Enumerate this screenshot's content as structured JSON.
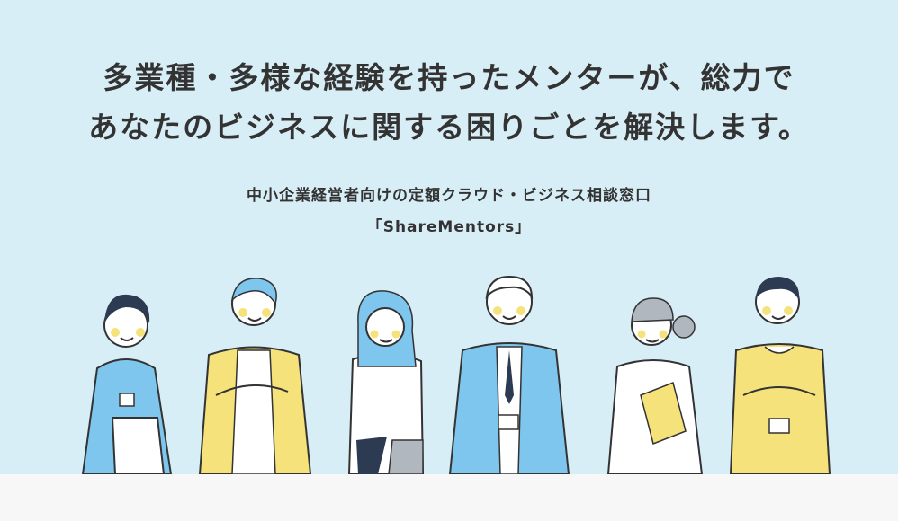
{
  "hero": {
    "headline_line1": "多業種・多様な経験を持ったメンターが、総力で",
    "headline_line2": "あなたのビジネスに関する困りごとを解決します。",
    "subtitle_line1": "中小企業経営者向けの定額クラウド・ビジネス相談窓口",
    "subtitle_line2": "「ShareMentors」"
  },
  "colors": {
    "background": "#d8eef6",
    "bottom_band": "#f7f7f7",
    "text": "#333333",
    "accent_blue": "#7fc6ee",
    "accent_yellow": "#f6e27a"
  },
  "illustration": {
    "figures": [
      "mentor-woman-blue-shirt",
      "mentor-man-yellow-jacket",
      "mentor-woman-long-hair",
      "mentor-man-blue-suit",
      "mentor-woman-white-jacket",
      "mentor-man-yellow-sweater"
    ]
  }
}
